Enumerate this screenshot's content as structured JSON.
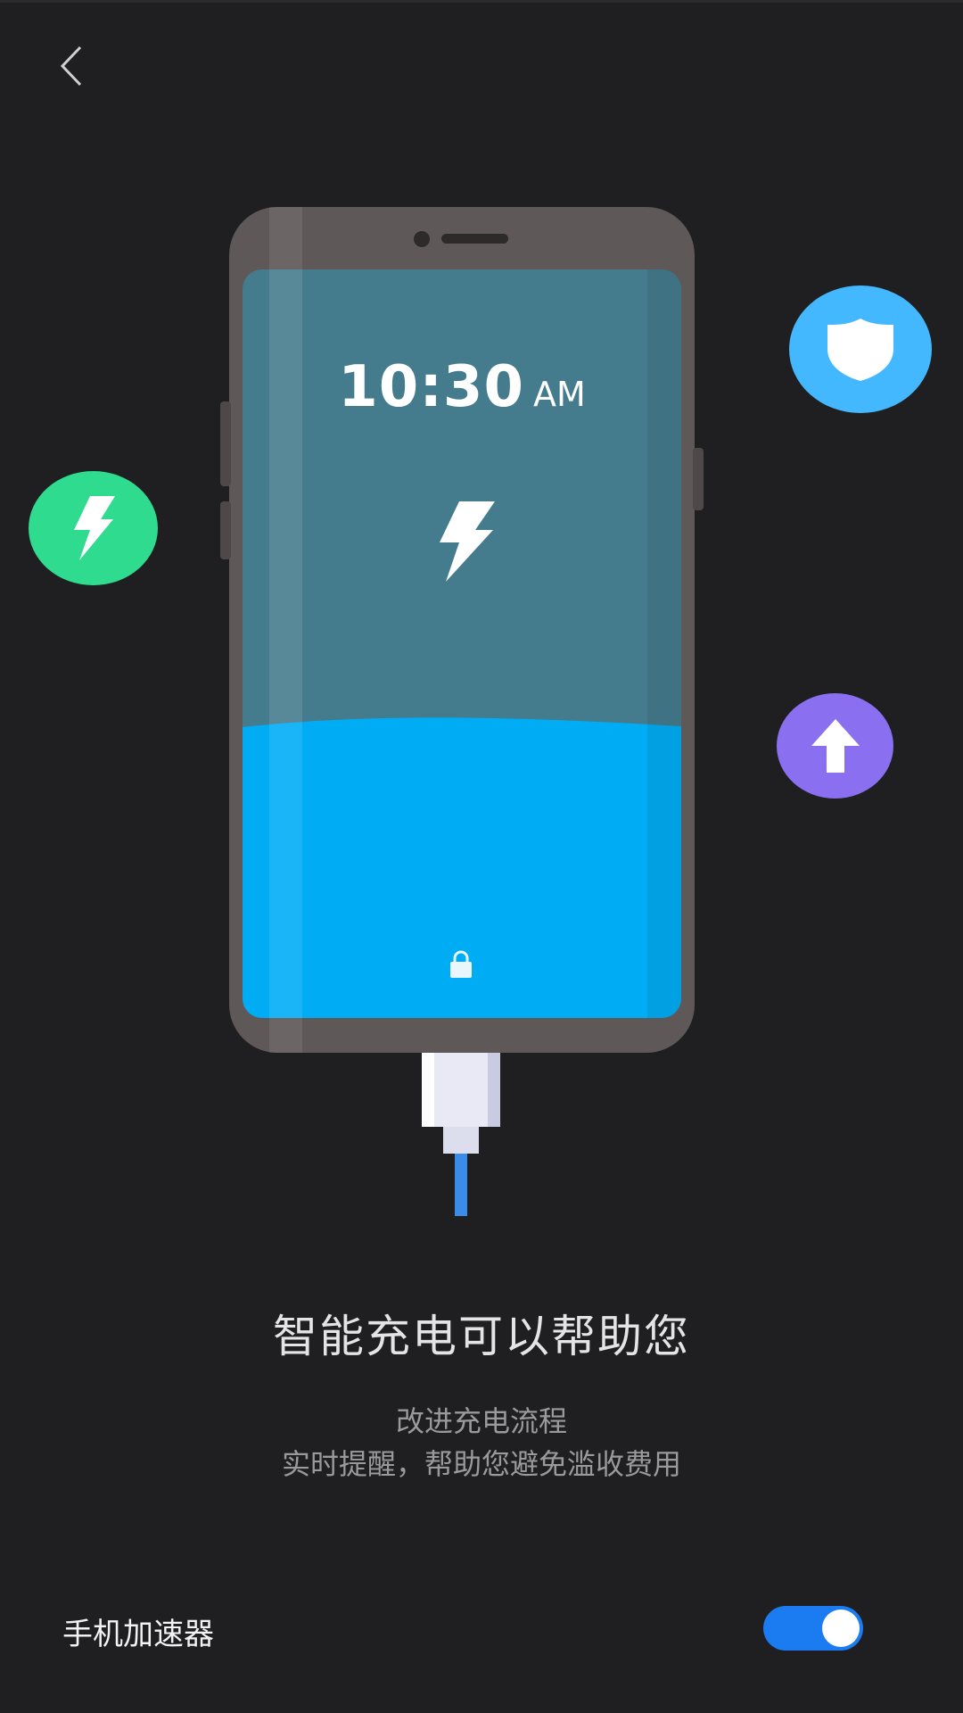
{
  "nav": {
    "back_icon": "chevron-left-icon"
  },
  "illustration": {
    "clock_time": "10:30",
    "clock_ampm": "AM",
    "screen_icon": "lightning-bolt-icon",
    "lock_icon": "lock-icon",
    "badges": [
      {
        "icon": "lightning-bolt-icon",
        "color": "#2fdc8f"
      },
      {
        "icon": "shield-icon",
        "color": "#43b8ff"
      },
      {
        "icon": "arrow-up-icon",
        "color": "#8a6ff0"
      }
    ],
    "screen_color": "#447c8e",
    "liquid_color": "#00adf5"
  },
  "intro": {
    "title": "智能充电可以帮助您",
    "line1": "改进充电流程",
    "line2": "实时提醒，帮助您避免滥收费用"
  },
  "setting": {
    "label": "手机加速器",
    "enabled": true,
    "accent": "#1a7cf0"
  }
}
